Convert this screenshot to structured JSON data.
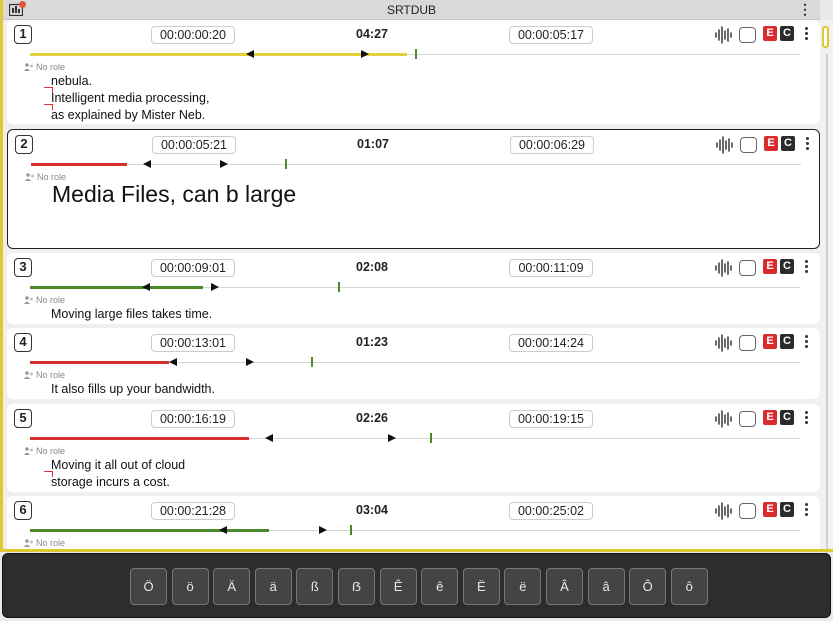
{
  "app": {
    "title": "SRTDUB"
  },
  "colors": {
    "accent": "#e0c830",
    "red": "#d33030",
    "green": "#4b8a2a",
    "yellow": "#e3d03d"
  },
  "cues": [
    {
      "number": "1",
      "start": "00:00:00:20",
      "duration": "04:27",
      "end": "00:00:05:17",
      "role": "No role",
      "lines": [
        "nebula.",
        "Intelligent media processing,",
        "as explained by Mister Neb."
      ],
      "big": false,
      "bar_color": "yellow",
      "fill": 0.49,
      "left_marker": 0.28,
      "right_marker": 0.43,
      "tick": 0.5
    },
    {
      "number": "2",
      "start": "00:00:05:21",
      "duration": "01:07",
      "end": "00:00:06:29",
      "role": "No role",
      "lines": [
        "Media Files, can b large"
      ],
      "big": true,
      "bar_color": "red",
      "fill": 0.125,
      "left_marker": 0.145,
      "right_marker": 0.245,
      "tick": 0.33
    },
    {
      "number": "3",
      "start": "00:00:09:01",
      "duration": "02:08",
      "end": "00:00:11:09",
      "role": "No role",
      "lines": [
        "Moving large files takes time."
      ],
      "big": false,
      "bar_color": "green",
      "fill": 0.225,
      "left_marker": 0.145,
      "right_marker": 0.235,
      "tick": 0.4
    },
    {
      "number": "4",
      "start": "00:00:13:01",
      "duration": "01:23",
      "end": "00:00:14:24",
      "role": "No role",
      "lines": [
        "It also fills up your bandwidth."
      ],
      "big": false,
      "bar_color": "red",
      "fill": 0.18,
      "left_marker": 0.18,
      "right_marker": 0.28,
      "tick": 0.365
    },
    {
      "number": "5",
      "start": "00:00:16:19",
      "duration": "02:26",
      "end": "00:00:19:15",
      "role": "No role",
      "lines": [
        "Moving it all out of cloud",
        "storage incurs a cost."
      ],
      "big": false,
      "bar_color": "red",
      "fill": 0.285,
      "left_marker": 0.305,
      "right_marker": 0.465,
      "tick": 0.52
    },
    {
      "number": "6",
      "start": "00:00:21:28",
      "duration": "03:04",
      "end": "00:00:25:02",
      "role": "No role",
      "lines": [],
      "big": false,
      "bar_color": "green",
      "fill": 0.31,
      "left_marker": 0.245,
      "right_marker": 0.375,
      "tick": 0.415
    }
  ],
  "keyboard": {
    "keys": [
      "Ö",
      "ö",
      "Ä",
      "ä",
      "ß",
      "ẞ",
      "Ê",
      "ê",
      "Ë",
      "ë",
      "Â",
      "â",
      "Ô",
      "ô"
    ]
  }
}
